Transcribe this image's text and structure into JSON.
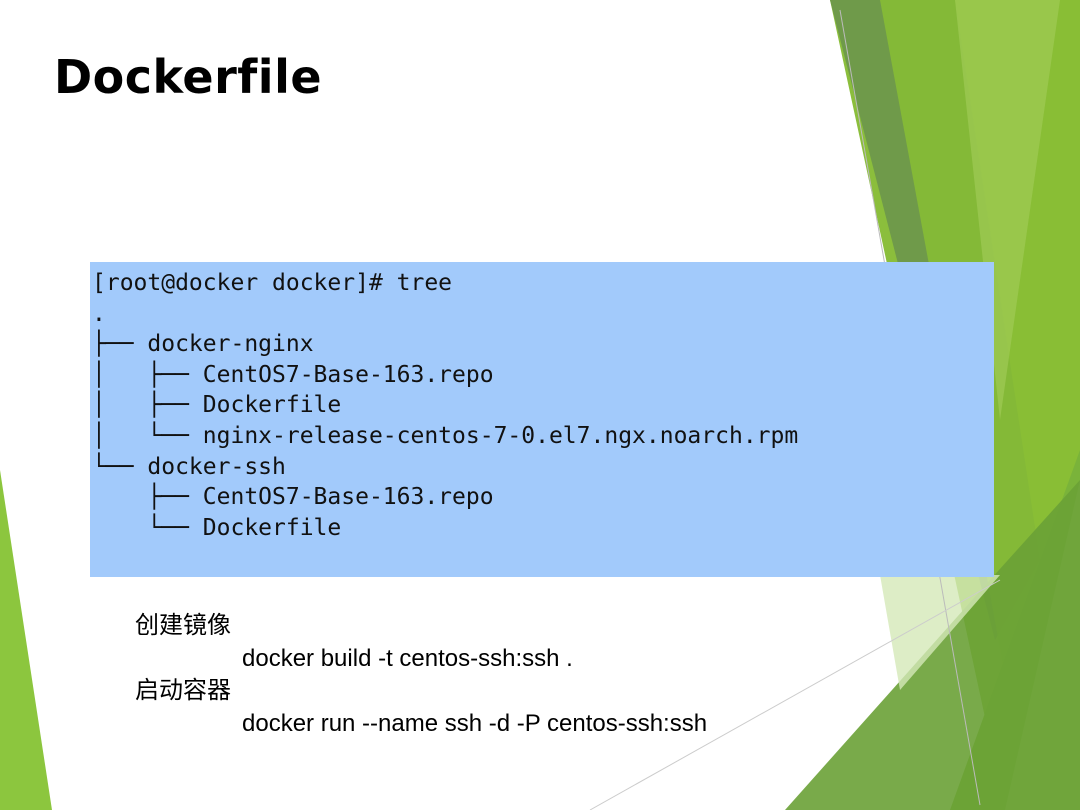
{
  "slide": {
    "title": "Dockerfile",
    "terminal": {
      "lines": [
        "[root@docker docker]# tree",
        ".",
        "├── docker-nginx",
        "│   ├── CentOS7-Base-163.repo",
        "│   ├── Dockerfile",
        "│   └── nginx-release-centos-7-0.el7.ngx.noarch.rpm",
        "└── docker-ssh",
        "    ├── CentOS7-Base-163.repo",
        "    └── Dockerfile"
      ]
    },
    "notes": {
      "build_label": "创建镜像",
      "build_cmd": "docker build -t centos-ssh:ssh .",
      "run_label": "启动容器",
      "run_cmd": "docker run --name ssh -d -P centos-ssh:ssh"
    }
  },
  "colors": {
    "terminal_bg": "#a2cafb",
    "accent_green": "#8dc63f",
    "dark_green": "#6aa136"
  }
}
